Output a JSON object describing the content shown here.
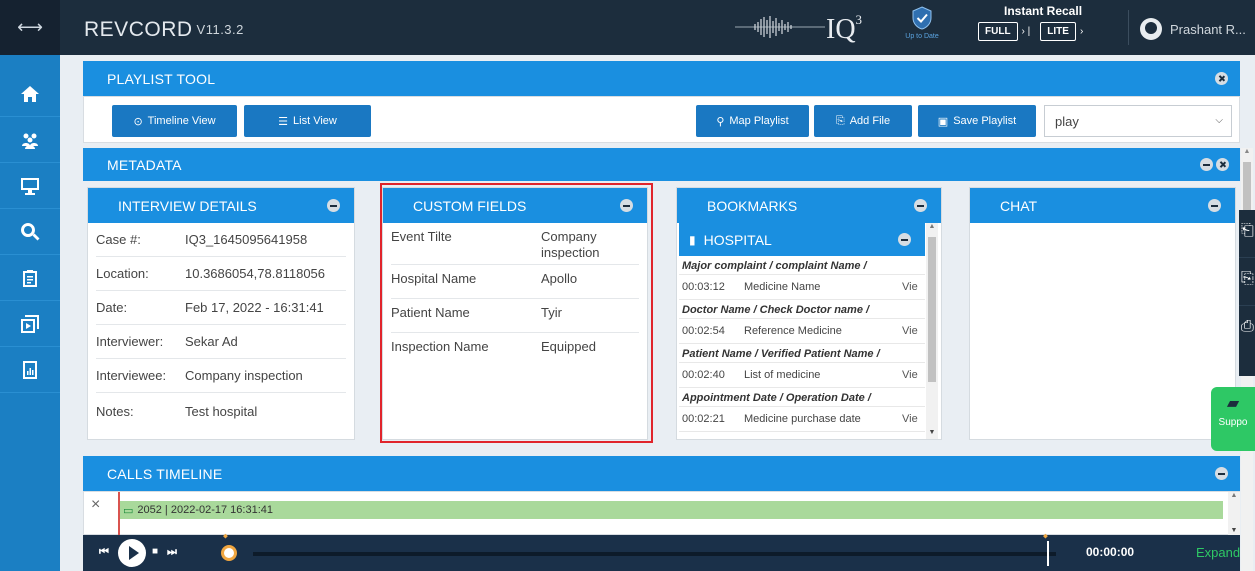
{
  "header": {
    "logo_prefix": "REV",
    "logo_suffix": "CORD",
    "version": "V11.3.2",
    "iq_label": "IQ",
    "iq_sup": "3",
    "shield_caption": "Up to Date",
    "instant_recall": "Instant Recall",
    "full_label": "FULL",
    "lite_label": "LITE",
    "sep1": "› |",
    "sep2": "›",
    "user_name": "Prashant R..."
  },
  "sidebar": {
    "items": [
      {
        "icon": "home-icon"
      },
      {
        "icon": "users-icon"
      },
      {
        "icon": "monitor-icon"
      },
      {
        "icon": "search-icon"
      },
      {
        "icon": "clipboard-icon"
      },
      {
        "icon": "playlist-icon"
      },
      {
        "icon": "report-icon"
      }
    ]
  },
  "playlist_tool": {
    "title": "PLAYLIST TOOL",
    "timeline_view": "Timeline View",
    "list_view": "List View",
    "map_playlist": "Map Playlist",
    "add_file": "Add File",
    "save_playlist": "Save Playlist",
    "selected_playlist": "play"
  },
  "metadata": {
    "title": "METADATA",
    "interview_details": {
      "title": "INTERVIEW DETAILS",
      "rows": [
        {
          "label": "Case #:",
          "value": "IQ3_1645095641958"
        },
        {
          "label": "Location:",
          "value": "10.3686054,78.8118056"
        },
        {
          "label": "Date:",
          "value": "Feb 17, 2022 - 16:31:41"
        },
        {
          "label": "Interviewer:",
          "value": "Sekar Ad"
        },
        {
          "label": "Interviewee:",
          "value": "Company inspection"
        },
        {
          "label": "Notes:",
          "value": "Test hospital"
        }
      ]
    },
    "custom_fields": {
      "title": "CUSTOM FIELDS",
      "rows": [
        {
          "label": "Event Tilte",
          "value": "Company inspection"
        },
        {
          "label": "Hospital Name",
          "value": "Apollo"
        },
        {
          "label": "Patient Name",
          "value": "Tyir"
        },
        {
          "label": "Inspection Name",
          "value": "Equipped"
        }
      ]
    },
    "bookmarks": {
      "title": "BOOKMARKS",
      "group": "HOSPITAL",
      "entries": [
        {
          "heading": "Major complaint / complaint Name /",
          "time": "00:03:12",
          "name": "Medicine Name",
          "action": "Vie"
        },
        {
          "heading": "Doctor Name / Check Doctor name /",
          "time": "00:02:54",
          "name": "Reference Medicine",
          "action": "Vie"
        },
        {
          "heading": "Patient Name / Verified Patient Name /",
          "time": "00:02:40",
          "name": "List of medicine",
          "action": "Vie"
        },
        {
          "heading": "Appointment Date / Operation Date /",
          "time": "00:02:21",
          "name": "Medicine purchase date",
          "action": "Vie"
        }
      ]
    },
    "chat": {
      "title": "CHAT"
    }
  },
  "calls_timeline": {
    "title": "CALLS TIMELINE",
    "close": "×",
    "call_label": "2052 | 2022-02-17 16:31:41"
  },
  "player": {
    "time": "00:00:00",
    "expand": "Expand"
  },
  "support": {
    "label": "Suppo"
  },
  "colors": {
    "topbar": "#1c2d3d",
    "sidebar": "#1b7fc3",
    "header_bar": "#1a8fe0",
    "button": "#1a78c2",
    "highlight": "#e0242b",
    "support": "#2ec865",
    "timeline_fill": "#a9d99b"
  }
}
